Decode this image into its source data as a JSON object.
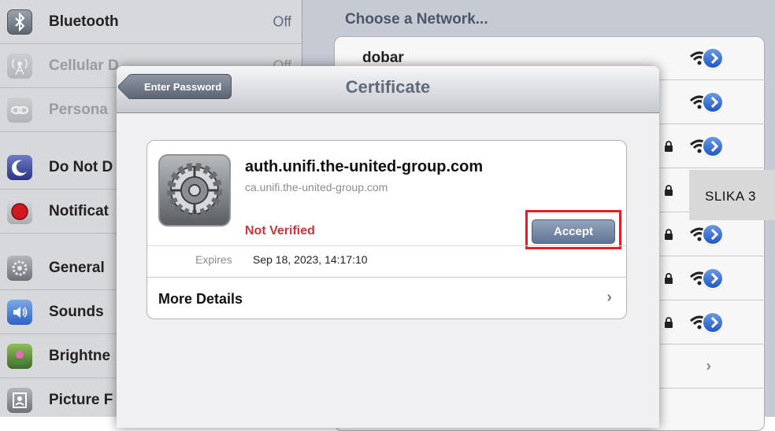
{
  "sidebar": {
    "items": [
      {
        "label": "Bluetooth",
        "value": "Off",
        "icon": "bluetooth-icon",
        "dimmed": false
      },
      {
        "label": "Cellular D",
        "value": "Off",
        "icon": "cellular-icon",
        "dimmed": true
      },
      {
        "label": "Persona",
        "value": "",
        "icon": "personal-hotspot-icon",
        "dimmed": true
      },
      {
        "label": "Do Not D",
        "value": "",
        "icon": "moon-icon",
        "dimmed": false
      },
      {
        "label": "Notificat",
        "value": "",
        "icon": "notifications-icon",
        "dimmed": false
      },
      {
        "label": "General",
        "value": "",
        "icon": "gear-icon",
        "dimmed": false
      },
      {
        "label": "Sounds",
        "value": "",
        "icon": "speaker-icon",
        "dimmed": false
      },
      {
        "label": "Brightne",
        "value": "",
        "icon": "brightness-icon",
        "dimmed": false
      },
      {
        "label": "Picture F",
        "value": "",
        "icon": "picture-frame-icon",
        "dimmed": false
      }
    ]
  },
  "wifi": {
    "header": "Choose a Network...",
    "networks": [
      {
        "name": "dobar",
        "locked": false
      },
      {
        "name": "",
        "locked": false
      },
      {
        "name": "",
        "locked": true
      },
      {
        "name": "",
        "locked": true
      },
      {
        "name": "",
        "locked": true
      },
      {
        "name": "",
        "locked": true
      },
      {
        "name": "",
        "locked": true
      }
    ],
    "other_chevron": "›"
  },
  "modal": {
    "back_button": "Enter Password",
    "title": "Certificate",
    "cert": {
      "name": "auth.unifi.the-united-group.com",
      "issuer": "ca.unifi.the-united-group.com",
      "status": "Not Verified",
      "accept_label": "Accept",
      "expires_label": "Expires",
      "expires_value": "Sep 18, 2023, 14:17:10",
      "more_details": "More Details",
      "chevron": "›"
    }
  },
  "caption": "SLIKA 3",
  "colors": {
    "not_verified": "#c9353a",
    "highlight_box": "#e01f26",
    "detail_button": "#2a62cc"
  }
}
